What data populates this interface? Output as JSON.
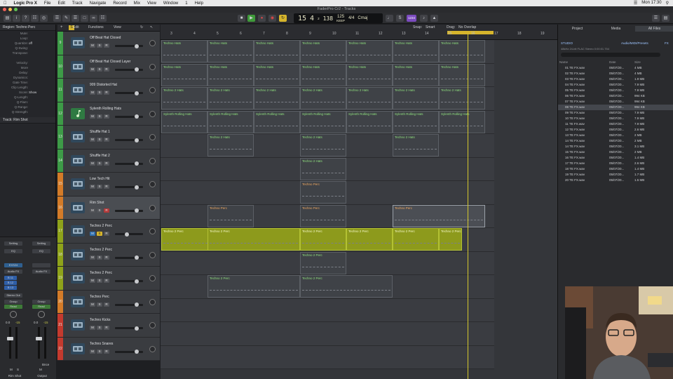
{
  "menubar": {
    "app": "Logic Pro X",
    "items": [
      "File",
      "Edit",
      "Track",
      "Navigate",
      "Record",
      "Mix",
      "View",
      "Window",
      "1",
      "Help"
    ],
    "clock": "Mon 17:30"
  },
  "window": {
    "title": "FaderPro Cr2 - Tracks"
  },
  "lcd": {
    "bar": "15",
    "beat": "4",
    "div": "2",
    "tick": "138",
    "tempo": "125",
    "tempo_label": "KEEP",
    "tempo_sub": "TEMPO",
    "sig_top": "4/4",
    "key": "Cmaj",
    "bar_label": "BAR",
    "beat_label": "BEAT",
    "cpu": "1234"
  },
  "inspector": {
    "region_label": "Region: Techno Perc",
    "rows": [
      {
        "k": "Mute:",
        "v": ""
      },
      {
        "k": "Loop:",
        "v": ""
      },
      {
        "k": "Quantize:",
        "v": "off"
      },
      {
        "k": "Q-Swing:",
        "v": ""
      },
      {
        "k": "Transpose:",
        "v": ""
      },
      {
        "k": "",
        "v": ""
      },
      {
        "k": "Velocity:",
        "v": ""
      },
      {
        "k": "More",
        "v": ""
      },
      {
        "k": "Delay:",
        "v": ""
      },
      {
        "k": "Dynamics:",
        "v": ""
      },
      {
        "k": "Gate Time:",
        "v": ""
      },
      {
        "k": "Clip Length:",
        "v": ""
      },
      {
        "k": "Score:",
        "v": "Show"
      },
      {
        "k": "Q-Length:",
        "v": ""
      },
      {
        "k": "Q-Flam:",
        "v": ""
      },
      {
        "k": "Q-Range:",
        "v": ""
      },
      {
        "k": "Q-Strength:",
        "v": ""
      }
    ],
    "track_label": "Track:  Rim Shot",
    "strip": {
      "setting": "Setting",
      "eq": "EQ",
      "input": "EXS24",
      "audio_fx": "Audio FX",
      "sends": [
        "B 11",
        "B 12",
        "B 13"
      ],
      "stereo_out": "Stereo Out",
      "group": "Group",
      "read": "Read",
      "vol_left": "0.0",
      "vol_right": "-15",
      "bnce": "Bnce",
      "name_left": "Rim Shot",
      "name_right": "Output",
      "m": "M",
      "s": "S",
      "i": "I"
    }
  },
  "tracks_toolbar": {
    "edit": "Edit",
    "functions": "Functions",
    "view": "View"
  },
  "arrange_toolbar": {
    "snap_label": "Snap:",
    "snap": "Smart",
    "drag_label": "Drag:",
    "drag": "No Overlap"
  },
  "ruler": [
    "3",
    "4",
    "5",
    "6",
    "7",
    "8",
    "9",
    "10",
    "11",
    "12",
    "13",
    "14",
    "15",
    "16",
    "17",
    "18",
    "19"
  ],
  "tracks": [
    {
      "num": "9",
      "name": "Off Beat Hat Closed",
      "color": "#3d9b47"
    },
    {
      "num": "10",
      "name": "Off Beat Hat Closed Layer",
      "color": "#3d9b47"
    },
    {
      "num": "11",
      "name": "909 Distorted Hat",
      "color": "#3d9b47"
    },
    {
      "num": "12",
      "name": "Sylenth Rolling Hats",
      "color": "#3d9b47"
    },
    {
      "num": "13",
      "name": "Shuffle Hat 1",
      "color": "#3d9b47"
    },
    {
      "num": "14",
      "name": "Shuffle Hat 2",
      "color": "#3d9b47"
    },
    {
      "num": "15",
      "name": "Low Tech Hit",
      "color": "#d47b28"
    },
    {
      "num": "16",
      "name": "Rim Shot",
      "color": "#d47b28"
    },
    {
      "num": "17",
      "name": "Techno 2 Perc",
      "color": "#8fa31a"
    },
    {
      "num": "18",
      "name": "Techno 2 Perc",
      "color": "#8fa31a"
    },
    {
      "num": "19",
      "name": "Techno 2 Perc",
      "color": "#8fa31a"
    },
    {
      "num": "20",
      "name": "Techno Perc",
      "color": "#d47b28"
    },
    {
      "num": "21",
      "name": "Techno Kicks",
      "color": "#c43a2e"
    },
    {
      "num": "22",
      "name": "Techno Snares",
      "color": "#c43a2e"
    }
  ],
  "track_buttons": {
    "m": "M",
    "s": "S",
    "r": "R"
  },
  "region_names": {
    "hats": "Techno Hats",
    "hats2": "Techno 2 Hats",
    "sylenth": "Sylenth Rolling Hats",
    "perc": "Techno Perc",
    "perc2": "Techno 2 Perc"
  },
  "browser": {
    "tabs": [
      "Project",
      "Media",
      "All Files"
    ],
    "path": "STUDIO",
    "path_right": "Audio/MIDI/Presets",
    "path_end": "FX",
    "info": "48kHz  24-bit  FLAC  Stereo  0:00:01.754",
    "cols": [
      "Name",
      "Date",
      "Size"
    ],
    "files": [
      {
        "name": "01 TE FX.wav",
        "date": "05/07/20...",
        "size": "4 MB"
      },
      {
        "name": "02 TE FX.wav",
        "date": "05/07/20...",
        "size": "4 MB"
      },
      {
        "name": "03 TE FX.wav",
        "date": "05/07/20...",
        "size": "1.9 MB"
      },
      {
        "name": "04 TE FX.wav",
        "date": "05/07/20...",
        "size": "7.9 MB"
      },
      {
        "name": "05 TE FX.wav",
        "date": "05/07/20...",
        "size": "7.9 MB"
      },
      {
        "name": "06 TE FX.wav",
        "date": "05/07/20...",
        "size": "994 KB"
      },
      {
        "name": "07 TE FX.wav",
        "date": "05/07/20...",
        "size": "994 KB"
      },
      {
        "name": "08 TE FX.wav",
        "date": "05/07/20...",
        "size": "994 KB"
      },
      {
        "name": "09 TE FX.wav",
        "date": "05/07/20...",
        "size": "7.9 MB"
      },
      {
        "name": "10 TE FX.wav",
        "date": "05/07/20...",
        "size": "7.9 MB"
      },
      {
        "name": "11 TE FX.wav",
        "date": "05/07/20...",
        "size": "7.9 MB"
      },
      {
        "name": "12 TE FX.wav",
        "date": "05/07/20...",
        "size": "2.6 MB"
      },
      {
        "name": "13 TE FX.wav",
        "date": "05/07/20...",
        "size": "2 MB"
      },
      {
        "name": "14 TE FX.wav",
        "date": "05/07/20...",
        "size": "2 MB"
      },
      {
        "name": "14 TE FX.wav",
        "date": "05/07/20...",
        "size": "3.1 MB"
      },
      {
        "name": "15 TE FX.wav",
        "date": "05/07/20...",
        "size": "2 MB"
      },
      {
        "name": "16 TE FX.wav",
        "date": "05/07/20...",
        "size": "1.4 MB"
      },
      {
        "name": "17 TE FX.wav",
        "date": "05/07/20...",
        "size": "2.6 MB"
      },
      {
        "name": "18 TE FX.wav",
        "date": "05/07/20...",
        "size": "1.4 MB"
      },
      {
        "name": "19 TE FX.wav",
        "date": "05/07/20...",
        "size": "1.7 MB"
      },
      {
        "name": "20 TE FX.wav",
        "date": "05/07/20...",
        "size": "1.5 MB"
      }
    ],
    "selected_index": 7
  },
  "colors": {
    "region_selected": "#8d9a1c",
    "accent_yellow": "#d6b52c",
    "track_selected": "#4a4d52"
  }
}
